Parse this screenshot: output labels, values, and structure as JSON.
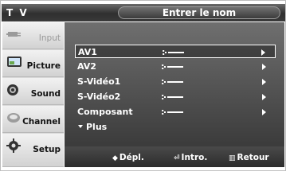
{
  "header": {
    "app_label": "T V",
    "title": "Entrer le nom"
  },
  "sidebar": {
    "items": [
      {
        "label": "Input",
        "icon": "input-plug-icon",
        "active": false
      },
      {
        "label": "Picture",
        "icon": "picture-icon",
        "active": true
      },
      {
        "label": "Sound",
        "icon": "speaker-icon",
        "active": true
      },
      {
        "label": "Channel",
        "icon": "channel-antenna-icon",
        "active": true
      },
      {
        "label": "Setup",
        "icon": "gear-icon",
        "active": true
      }
    ]
  },
  "menu": {
    "rows": [
      {
        "name": "AV1",
        "value": "----",
        "colon": ":"
      },
      {
        "name": "AV2",
        "value": "----",
        "colon": ":"
      },
      {
        "name": "S-Vidéo1",
        "value": "----",
        "colon": ":"
      },
      {
        "name": "S-Vidéo2",
        "value": "----",
        "colon": ":"
      },
      {
        "name": "Composant",
        "value": "----",
        "colon": ":"
      }
    ],
    "more_label": "Plus",
    "selected_index": 0
  },
  "footer": {
    "move": "Dépl.",
    "enter": "Intro.",
    "return": "Retour"
  }
}
